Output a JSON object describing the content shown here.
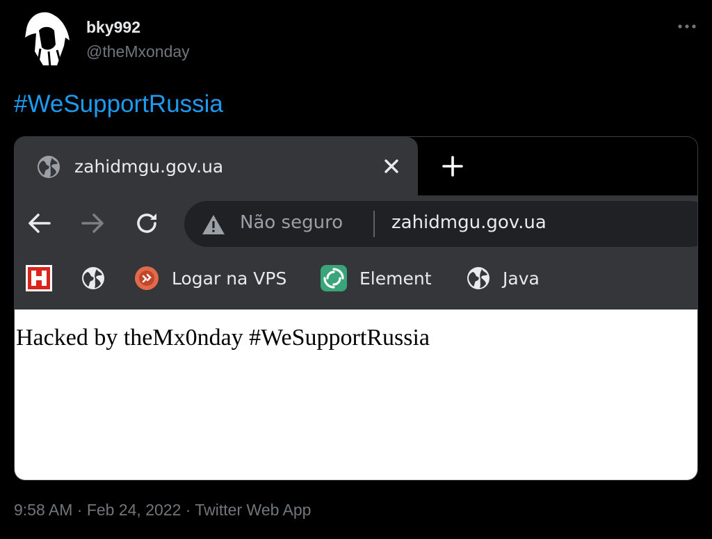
{
  "user": {
    "display_name": "bky992",
    "handle": "@theMxonday"
  },
  "tweet": {
    "text": "#WeSupportRussia",
    "hashtag_color": "#1d9bf0"
  },
  "browser": {
    "tab_title": "zahidmgu.gov.ua",
    "security_label": "Não seguro",
    "url": "zahidmgu.gov.ua",
    "bookmarks": [
      {
        "icon": "h-logo-icon",
        "label": ""
      },
      {
        "icon": "globe-icon",
        "label": ""
      },
      {
        "icon": "remote-desktop-icon",
        "label": "Logar na VPS"
      },
      {
        "icon": "element-icon",
        "label": "Element"
      },
      {
        "icon": "globe-icon",
        "label": "Java"
      }
    ],
    "page_text": "Hacked by theMx0nday #WeSupportRussia"
  },
  "footer": {
    "timestamp": "9:58 AM · Feb 24, 2022 · Twitter Web App"
  }
}
